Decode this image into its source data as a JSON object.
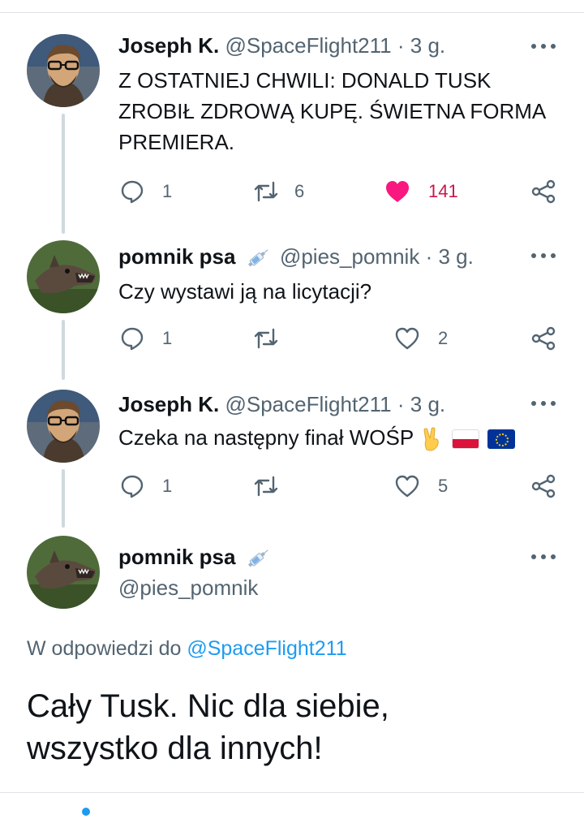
{
  "tweets": [
    {
      "name": "Joseph K.",
      "handle": "@SpaceFlight211",
      "dot": "·",
      "time": "3 g.",
      "text_lines": [
        "Z OSTATNIEJ CHWILI: DONALD TUSK",
        "ZROBIŁ ZDROWĄ KUPĘ. ŚWIETNA FORMA",
        "PREMIERA."
      ],
      "replies": "1",
      "retweets": "6",
      "likes": "141",
      "liked": true
    },
    {
      "name": "pomnik psa",
      "handle": "@pies_pomnik",
      "dot": "·",
      "time": "3 g.",
      "text": "Czy wystawi ją na licytacji?",
      "replies": "1",
      "retweets": "",
      "likes": "2",
      "liked": false
    },
    {
      "name": "Joseph K.",
      "handle": "@SpaceFlight211",
      "dot": "·",
      "time": "3 g.",
      "text": "Czeka na następny finał WOŚP",
      "emojis": [
        "victory-hand",
        "flag-poland",
        "flag-eu"
      ],
      "replies": "1",
      "retweets": "",
      "likes": "5",
      "liked": false
    }
  ],
  "main_tweet": {
    "name": "pomnik psa",
    "handle": "@pies_pomnik",
    "reply_prefix": "W odpowiedzi do",
    "reply_to": "@SpaceFlight211",
    "text_lines": [
      "Cały Tusk. Nic dla siebie,",
      "wszystko dla innych!"
    ]
  },
  "colors": {
    "secondary": "#536471",
    "like": "#f91880",
    "link": "#1d9bf0",
    "thread_line": "#cfd9de"
  }
}
